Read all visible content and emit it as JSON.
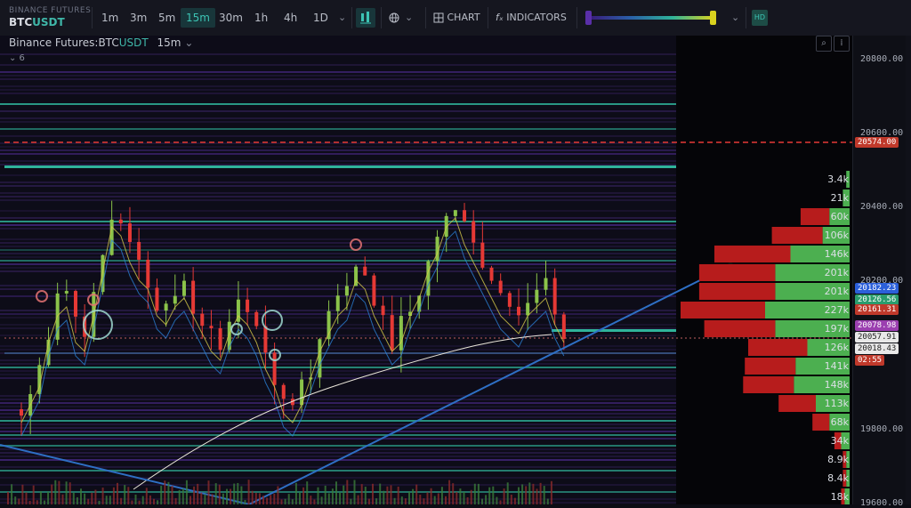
{
  "brand": {
    "exchange": "BINANCE FUTURES",
    "base": "BTC",
    "quote": "USDT"
  },
  "timeframes": [
    {
      "label": "1m",
      "active": false
    },
    {
      "label": "3m",
      "active": false
    },
    {
      "label": "5m",
      "active": false
    },
    {
      "label": "15m",
      "active": true
    },
    {
      "label": "30m",
      "active": false
    },
    {
      "label": "1h",
      "active": false
    },
    {
      "label": "4h",
      "active": false
    },
    {
      "label": "1D",
      "active": false
    }
  ],
  "toolbar": {
    "chart_label": "CHART",
    "indicators_label": "INDICATORS",
    "fx_symbol": "fₓ",
    "hd_label": "HD",
    "dropdown_glyph": "⌄"
  },
  "header": {
    "exchange": "Binance Futures",
    "separator": ":",
    "base": "BTC",
    "quote": "USDT",
    "interval": "15m"
  },
  "collapse": {
    "label": "⌄ 6"
  },
  "price_axis": {
    "ticks": [
      "20800.00",
      "20600.00",
      "20400.00",
      "20200.00",
      "19800.00",
      "19600.00"
    ]
  },
  "price_labels": [
    {
      "text": "20574.00",
      "bg": "#c0392b",
      "fg": "#ffffff"
    },
    {
      "text": "20182.23",
      "bg": "#2b5fd9",
      "fg": "#ffffff"
    },
    {
      "text": "20126.56",
      "bg": "#2a9d6e",
      "fg": "#ffffff"
    },
    {
      "text": "20161.31",
      "bg": "#c0392b",
      "fg": "#ffffff"
    },
    {
      "text": "20078.98",
      "bg": "#9b3fb0",
      "fg": "#ffffff"
    },
    {
      "text": "20057.91",
      "bg": "#e8e8e8",
      "fg": "#222222"
    },
    {
      "text": "20018.43",
      "bg": "#e8e8e8",
      "fg": "#222222"
    },
    {
      "text": "02:55",
      "bg": "#c0392b",
      "fg": "#ffffff"
    }
  ],
  "orderbook": {
    "labels": [
      "3.4k",
      "21k",
      "60k",
      "106k",
      "146k",
      "201k",
      "201k",
      "227k",
      "197k",
      "126k",
      "141k",
      "148k",
      "113k",
      "68k",
      "34k",
      "8.9k",
      "8.4k",
      "18k"
    ],
    "bars": [
      {
        "ask": 0,
        "bid": 0.02
      },
      {
        "ask": 0,
        "bid": 0.04
      },
      {
        "ask": 0.17,
        "bid": 0.12
      },
      {
        "ask": 0.3,
        "bid": 0.16
      },
      {
        "ask": 0.45,
        "bid": 0.35
      },
      {
        "ask": 0.45,
        "bid": 0.44
      },
      {
        "ask": 0.45,
        "bid": 0.44
      },
      {
        "ask": 0.5,
        "bid": 0.5
      },
      {
        "ask": 0.42,
        "bid": 0.44
      },
      {
        "ask": 0.35,
        "bid": 0.25
      },
      {
        "ask": 0.3,
        "bid": 0.32
      },
      {
        "ask": 0.3,
        "bid": 0.33
      },
      {
        "ask": 0.22,
        "bid": 0.2
      },
      {
        "ask": 0.1,
        "bid": 0.12
      },
      {
        "ask": 0.04,
        "bid": 0.05
      },
      {
        "ask": 0.02,
        "bid": 0.02
      },
      {
        "ask": 0.02,
        "bid": 0.02
      },
      {
        "ask": 0.02,
        "bid": 0.03
      }
    ]
  },
  "colors": {
    "bull": "#8bc34a",
    "bear": "#e53935",
    "ask_bar": "#b71c1c",
    "bid_bar": "#4caf50",
    "trendline": "#2e6fc4",
    "accent": "#3cc4b4"
  }
}
